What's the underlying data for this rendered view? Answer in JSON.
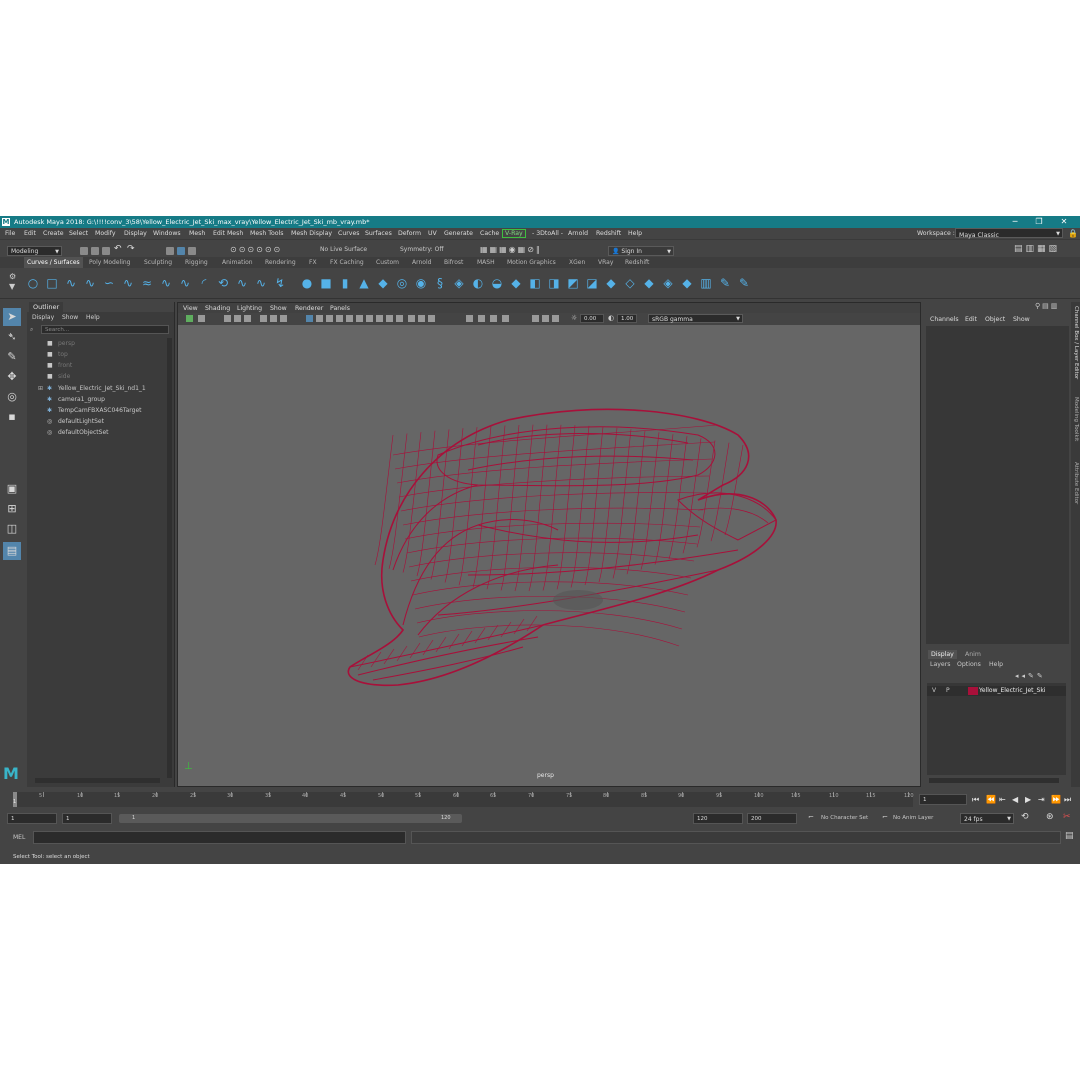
{
  "titlebar": {
    "title": "Autodesk Maya 2018: G:\\!!!!conv_3\\58\\Yellow_Electric_Jet_Ski_max_vray\\Yellow_Electric_Jet_Ski_mb_vray.mb*",
    "controls": [
      "─",
      "❐",
      "✕"
    ]
  },
  "menubar": {
    "items": [
      "File",
      "Edit",
      "Create",
      "Select",
      "Modify",
      "Display",
      "Windows",
      "Mesh",
      "Edit Mesh",
      "Mesh Tools",
      "Mesh Display",
      "Curves",
      "Surfaces",
      "Deform",
      "UV",
      "Generate",
      "Cache",
      "V-Ray",
      "- 3DtoAll -",
      "Arnold",
      "Redshift",
      "Help"
    ],
    "workspace_label": "Workspace :",
    "workspace_value": "Maya Classic"
  },
  "statusline": {
    "menu_set": "Modeling",
    "live_surface": "No Live Surface",
    "symmetry": "Symmetry: Off",
    "sign_in": "Sign In"
  },
  "shelf": {
    "tabs": [
      "Curves / Surfaces",
      "Poly Modeling",
      "Sculpting",
      "Rigging",
      "Animation",
      "Rendering",
      "FX",
      "FX Caching",
      "Custom",
      "Arnold",
      "Bifrost",
      "MASH",
      "Motion Graphics",
      "XGen",
      "VRay",
      "Redshift"
    ]
  },
  "outliner": {
    "title": "Outliner",
    "menu": [
      "Display",
      "Show",
      "Help"
    ],
    "search_placeholder": "Search...",
    "items": [
      {
        "label": "persp",
        "icon": "camera-icon",
        "dim": true
      },
      {
        "label": "top",
        "icon": "camera-icon",
        "dim": true
      },
      {
        "label": "front",
        "icon": "camera-icon",
        "dim": true
      },
      {
        "label": "side",
        "icon": "camera-icon",
        "dim": true
      },
      {
        "label": "Yellow_Electric_Jet_Ski_nd1_1",
        "icon": "group-icon",
        "dim": false
      },
      {
        "label": "camera1_group",
        "icon": "group-icon",
        "dim": false
      },
      {
        "label": "TempCamFBXASC046Target",
        "icon": "group-icon",
        "dim": false
      },
      {
        "label": "defaultLightSet",
        "icon": "set-icon",
        "dim": false
      },
      {
        "label": "defaultObjectSet",
        "icon": "set-icon",
        "dim": false
      }
    ]
  },
  "viewport": {
    "menu": [
      "View",
      "Shading",
      "Lighting",
      "Show",
      "Renderer",
      "Panels"
    ],
    "exposure": "0.00",
    "gamma": "1.00",
    "color_space": "sRGB gamma",
    "camera_label": "persp",
    "wire_color": "#a8103a"
  },
  "channelbox": {
    "menu": [
      "Channels",
      "Edit",
      "Object",
      "Show"
    ]
  },
  "layers": {
    "tabs": [
      "Display",
      "Anim"
    ],
    "menu": [
      "Layers",
      "Options",
      "Help"
    ],
    "row": {
      "v": "V",
      "p": "P",
      "name": "Yellow_Electric_Jet_Ski",
      "color": "#a8103a"
    }
  },
  "sidetabs": [
    "Channel Box / Layer Editor",
    "Modeling Toolkit",
    "Attribute Editor"
  ],
  "timeslider": {
    "ticks": [
      "5",
      "10",
      "15",
      "20",
      "25",
      "30",
      "35",
      "40",
      "45",
      "50",
      "55",
      "60",
      "65",
      "70",
      "75",
      "80",
      "85",
      "90",
      "95",
      "100",
      "105",
      "110",
      "115",
      "120"
    ],
    "current_frame_marker": "1",
    "current_frame": "1"
  },
  "range": {
    "start": "1",
    "playback_start": "1",
    "slider_start": "1",
    "slider_end": "120",
    "playback_end": "120",
    "end": "200",
    "character_set": "No Character Set",
    "anim_layer": "No Anim Layer",
    "fps": "24 fps"
  },
  "commandline": {
    "label": "MEL"
  },
  "helpline": {
    "text": "Select Tool: select an object"
  }
}
